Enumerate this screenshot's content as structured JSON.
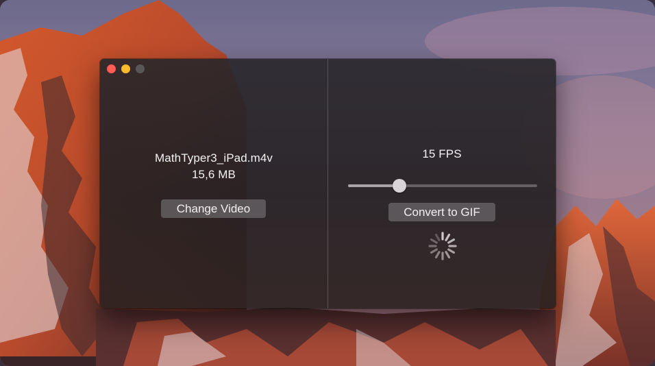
{
  "window": {
    "controls": {
      "close_icon": "close-icon",
      "minimize_icon": "minimize-icon",
      "zoom_icon": "zoom-icon"
    }
  },
  "left_pane": {
    "file_name": "MathTyper3_iPad.m4v",
    "file_size": "15,6 MB",
    "change_button_label": "Change Video"
  },
  "right_pane": {
    "fps_label": "15 FPS",
    "fps_slider_level": 0.27,
    "convert_button_label": "Convert to GIF",
    "progress_indicator": "spinner-icon"
  },
  "colors": {
    "close": "#fc5e56",
    "minimize": "#fdbc2e",
    "zoom_inactive": "#5a5658"
  }
}
